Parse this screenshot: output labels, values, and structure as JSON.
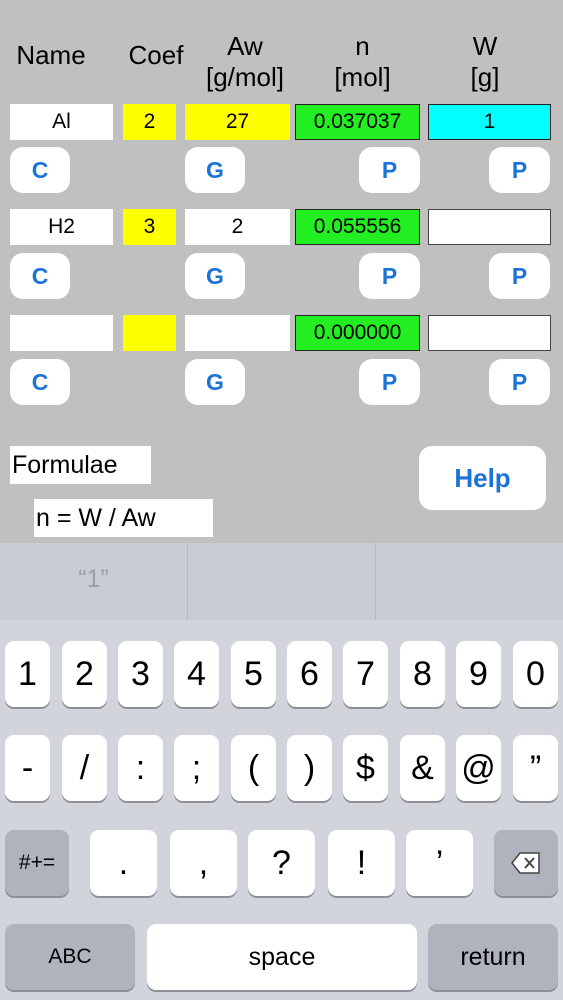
{
  "headers": {
    "name": "Name",
    "coef": "Coef",
    "aw": "Aw\n[g/mol]",
    "aw_l1": "Aw",
    "aw_l2": "[g/mol]",
    "n_l1": "n",
    "n_l2": "[mol]",
    "w_l1": "W",
    "w_l2": "[g]"
  },
  "rows": [
    {
      "name": "Al",
      "coef": "2",
      "aw": "27",
      "n": "0.037037",
      "w": "1"
    },
    {
      "name": "H2",
      "coef": "3",
      "aw": "2",
      "n": "0.055556",
      "w": ""
    },
    {
      "name": "",
      "coef": "",
      "aw": "",
      "n": "0.000000",
      "w": ""
    }
  ],
  "buttons": {
    "c": "C",
    "g": "G",
    "p": "P",
    "help": "Help"
  },
  "formulae": {
    "title": "Formulae",
    "text": "n = W / Aw"
  },
  "colors": {
    "yellow": "#ffff00",
    "green": "#22ee22",
    "cyan": "#00ffff",
    "button_text": "#1a73d6"
  },
  "keyboard": {
    "suggestion": "“1”",
    "row1": [
      "1",
      "2",
      "3",
      "4",
      "5",
      "6",
      "7",
      "8",
      "9",
      "0"
    ],
    "row2": [
      "-",
      "/",
      ":",
      ";",
      "(",
      ")",
      "$",
      "&",
      "@",
      "”"
    ],
    "row3": [
      ".",
      ",",
      "?",
      "!",
      "’"
    ],
    "symbols_key": "#+=",
    "abc_key": "ABC",
    "space_key": "space",
    "return_key": "return",
    "delete_icon": "delete-icon"
  }
}
